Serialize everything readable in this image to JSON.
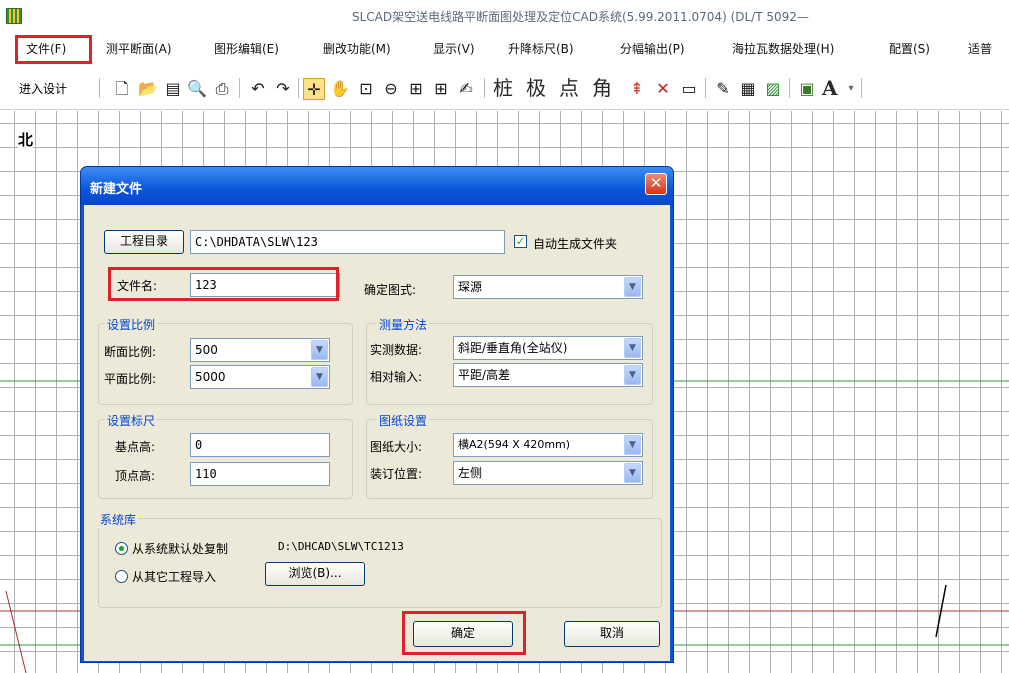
{
  "window": {
    "title": "SLCAD架空送电线路平断面图处理及定位CAD系统(5.99.2011.0704) (DL/T 5092—"
  },
  "menu": {
    "items": [
      "文件(F)",
      "测平断面(A)",
      "图形编辑(E)",
      "删改功能(M)",
      "显示(V)",
      "升降标尺(B)",
      "分幅输出(P)",
      "海拉瓦数据处理(H)",
      "配置(S)",
      "适普"
    ]
  },
  "toolbar": {
    "enter_design": "进入设计",
    "chars": [
      "桩",
      "极",
      "点",
      "角"
    ],
    "font_label": "A"
  },
  "canvas": {
    "north_label": "北"
  },
  "dialog": {
    "title": "新建文件",
    "project_dir_button": "工程目录",
    "project_dir_value": "C:\\DHDATA\\SLW\\123",
    "auto_folder_label": "自动生成文件夹",
    "auto_folder_checked": true,
    "file_name_label": "文件名:",
    "file_name_value": "123",
    "style_label": "确定图式:",
    "style_value": "琛源",
    "scale_group": "设置比例",
    "section_scale_label": "断面比例:",
    "section_scale_value": "500",
    "plane_scale_label": "平面比例:",
    "plane_scale_value": "5000",
    "measure_group": "测量方法",
    "measured_data_label": "实测数据:",
    "measured_data_value": "斜距/垂直角(全站仪)",
    "relative_input_label": "相对输入:",
    "relative_input_value": "平距/高差",
    "ruler_group": "设置标尺",
    "base_height_label": "基点高:",
    "base_height_value": "0",
    "top_height_label": "顶点高:",
    "top_height_value": "110",
    "paper_group": "图纸设置",
    "paper_size_label": "图纸大小:",
    "paper_size_value": "横A2(594 X 420mm)",
    "binding_label": "装订位置:",
    "binding_value": "左侧",
    "syslib_group": "系统库",
    "copy_default_label": "从系统默认处复制",
    "copy_default_path": "D:\\DHCAD\\SLW\\TC1213",
    "import_other_label": "从其它工程导入",
    "browse_button": "浏览(B)...",
    "ok_button": "确定",
    "cancel_button": "取消",
    "selected_source": "copy_default"
  },
  "colors": {
    "highlight": "#e0202a",
    "dialog_title": "#0a55d8",
    "group_title": "#0046d5"
  }
}
